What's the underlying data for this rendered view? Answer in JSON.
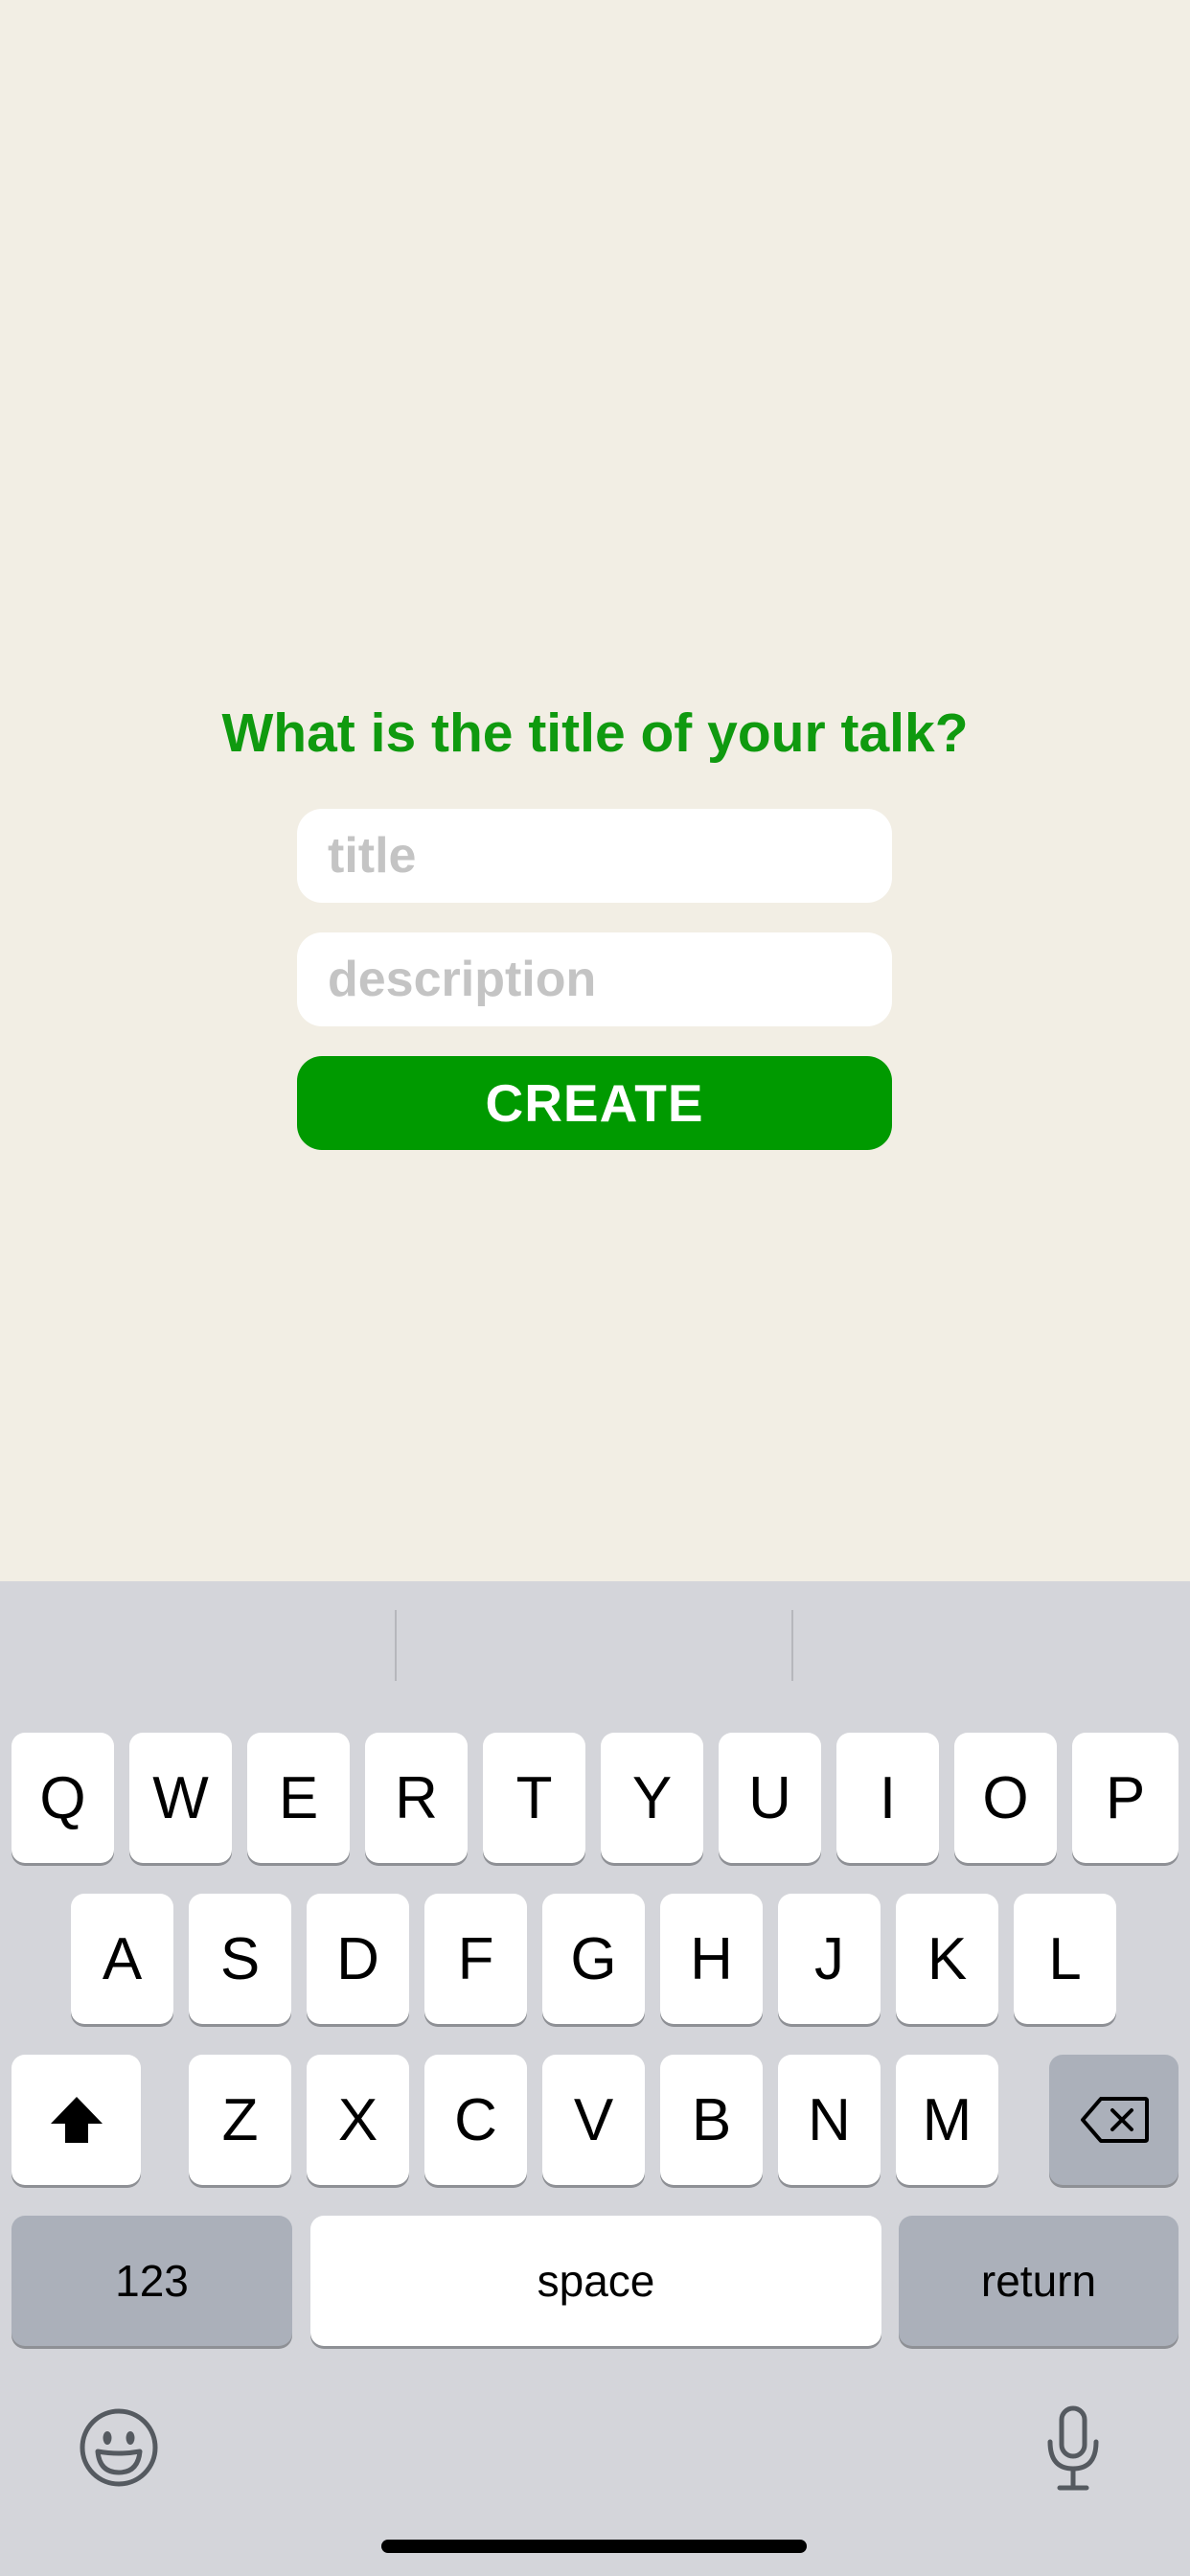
{
  "prompt": {
    "question": "What is the title of your talk?"
  },
  "form": {
    "title_placeholder": "title",
    "title_value": "",
    "description_placeholder": "description",
    "description_value": "",
    "create_label": "CREATE"
  },
  "keyboard": {
    "row1": [
      "Q",
      "W",
      "E",
      "R",
      "T",
      "Y",
      "U",
      "I",
      "O",
      "P"
    ],
    "row2": [
      "A",
      "S",
      "D",
      "F",
      "G",
      "H",
      "J",
      "K",
      "L"
    ],
    "row3": [
      "Z",
      "X",
      "C",
      "V",
      "B",
      "N",
      "M"
    ],
    "numbers_label": "123",
    "space_label": "space",
    "return_label": "return",
    "icons": [
      "shift-icon",
      "backspace-icon",
      "emoji-icon",
      "microphone-icon"
    ]
  },
  "colors": {
    "background": "#f2eee4",
    "accent": "#009a00",
    "question_text": "#0f9a0f",
    "keyboard_bg": "#d4d5da",
    "function_key": "#abb0ba"
  }
}
